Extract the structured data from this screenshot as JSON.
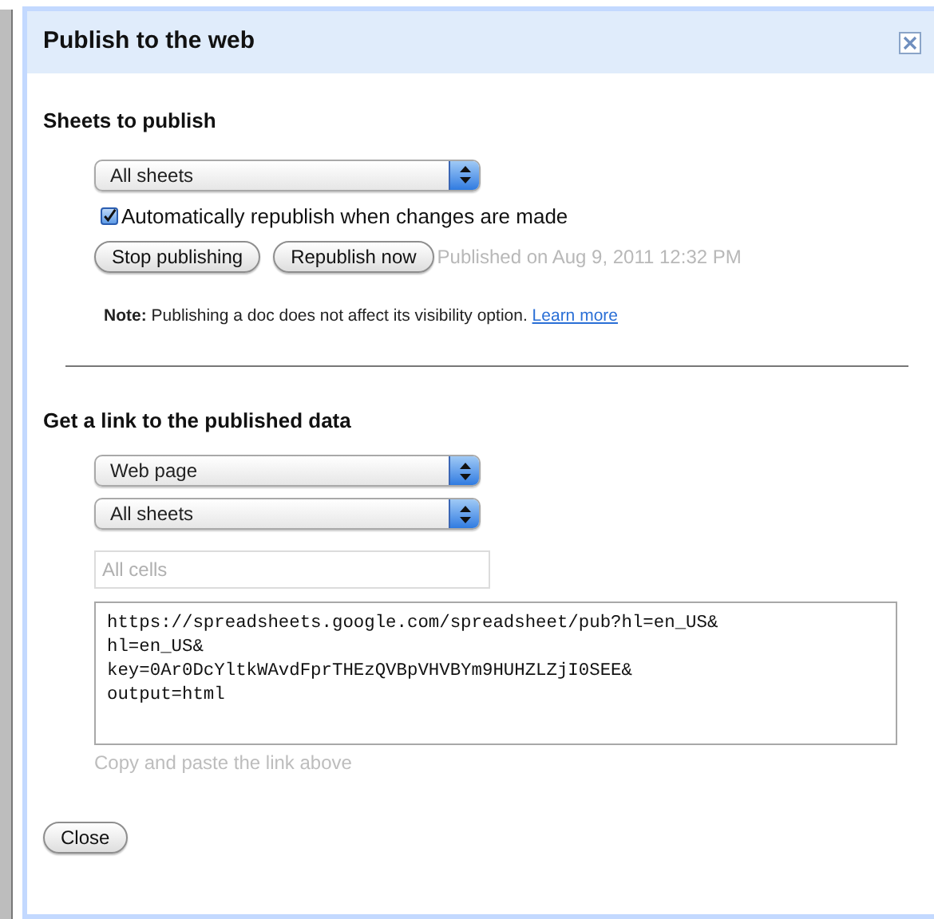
{
  "dialog": {
    "title": "Publish to the web"
  },
  "publish_section": {
    "heading": "Sheets to publish",
    "sheet_select": {
      "value": "All sheets"
    },
    "auto_republish": {
      "label": "Automatically republish when changes are made",
      "checked": true
    },
    "buttons": [
      "Stop publishing",
      "Republish now"
    ],
    "status": "Published on Aug 9, 2011 12:32 PM",
    "note": "**Note:** Publishing a doc does not affect its visibility option.",
    "note_link": "Learn more"
  },
  "link_section": {
    "heading": "Get a link to the published data",
    "format_select": {
      "value": "Web page"
    },
    "sheet_select": {
      "value": "All sheets"
    },
    "range_field": {
      "placeholder": "All cells"
    },
    "link": "https://spreadsheets.google.com/spreadsheet/pub?hl=en_US&\nhl=en_US&\nkey=0Ar0DcYltkWAvdFprTHEzQVBpVHVBYm9HUHZLZjI0SEE&\noutput=html",
    "hint": "Copy and paste the link above"
  },
  "footer_buttons": [
    "Close"
  ]
}
